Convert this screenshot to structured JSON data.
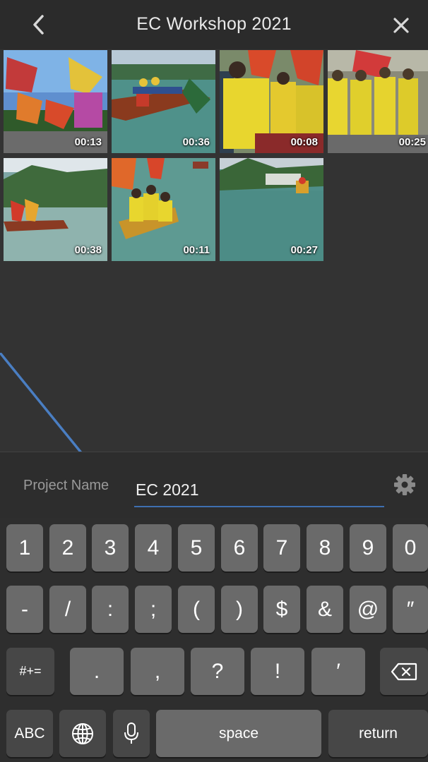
{
  "header": {
    "title": "EC Workshop 2021",
    "back_icon": "chevron-left-icon",
    "close_icon": "close-icon"
  },
  "clips": [
    {
      "duration": "00:13"
    },
    {
      "duration": "00:36"
    },
    {
      "duration": "00:08"
    },
    {
      "duration": "00:25"
    },
    {
      "duration": "00:38"
    },
    {
      "duration": "00:11"
    },
    {
      "duration": "00:27"
    }
  ],
  "project": {
    "label": "Project Name",
    "value": "EC 2021",
    "settings_icon": "gear-icon"
  },
  "keyboard": {
    "row1": [
      "1",
      "2",
      "3",
      "4",
      "5",
      "6",
      "7",
      "8",
      "9",
      "0"
    ],
    "row2": [
      "-",
      "/",
      ":",
      ";",
      "(",
      ")",
      "$",
      "&",
      "@",
      "″"
    ],
    "row3_left": "#+=",
    "row3": [
      ".",
      ",",
      "?",
      "!",
      "′"
    ],
    "row3_right_icon": "backspace-icon",
    "abc": "ABC",
    "globe_icon": "globe-icon",
    "mic_icon": "microphone-icon",
    "space": "space",
    "return": "return"
  },
  "colors": {
    "background": "#333333",
    "accent_underline": "#3e6fb0",
    "annotation_arrow": "#4a7ec2"
  }
}
